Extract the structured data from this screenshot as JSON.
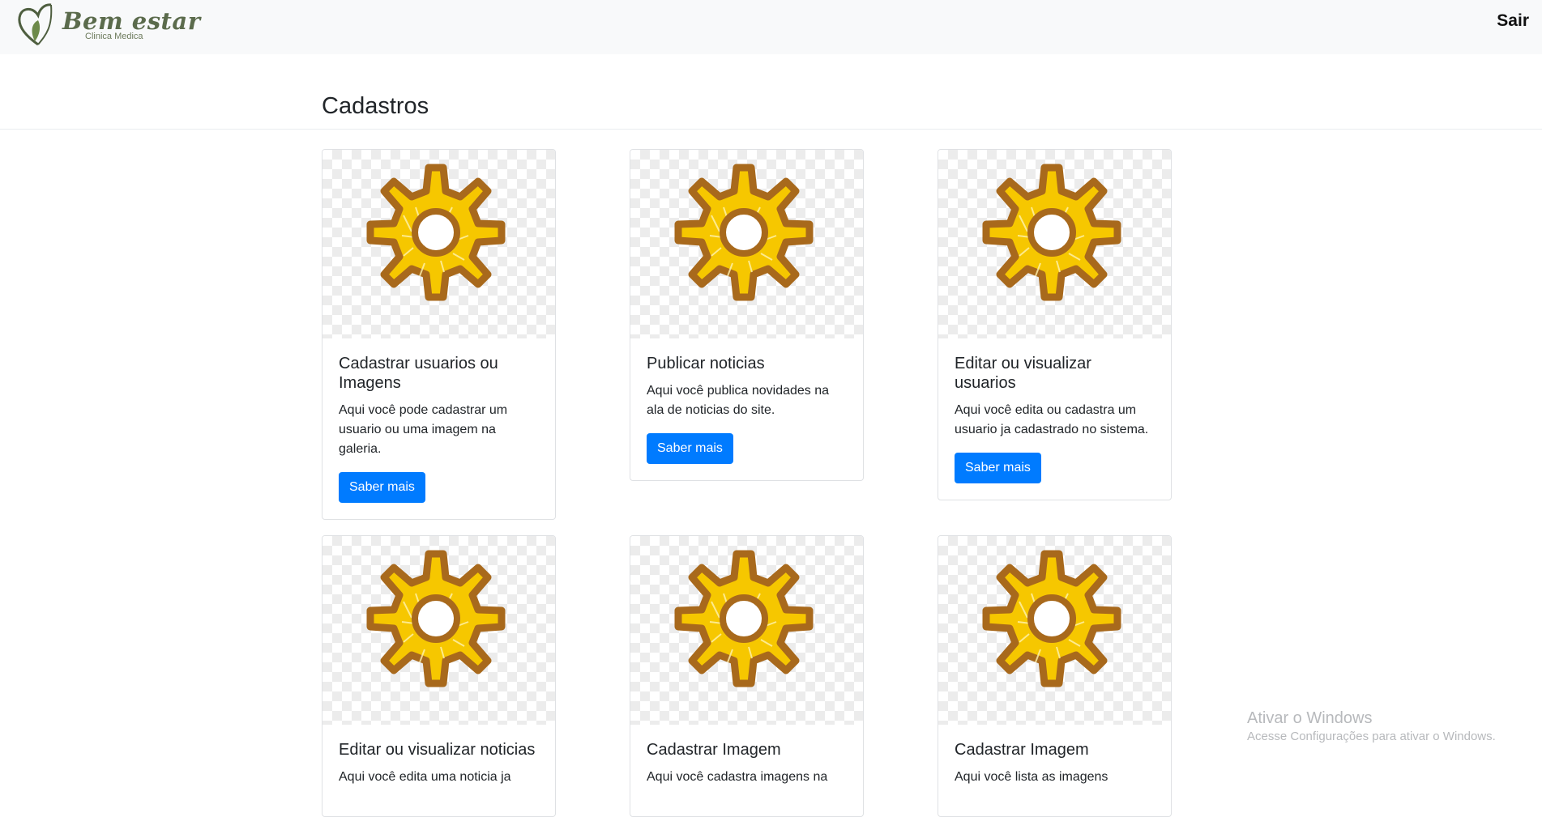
{
  "app": {
    "brand": "Bem estar",
    "subtitle": "Clinica Medica",
    "logout_label": "Sair"
  },
  "page": {
    "title": "Cadastros"
  },
  "cards": [
    {
      "title": "Cadastrar usuarios ou Imagens",
      "text": "Aqui você pode cadastrar um usuario ou uma imagem na galeria.",
      "button": "Saber mais",
      "icon": "gear-icon"
    },
    {
      "title": "Publicar noticias",
      "text": "Aqui você publica novidades na ala de noticias do site.",
      "button": "Saber mais",
      "icon": "gear-icon"
    },
    {
      "title": "Editar ou visualizar usuarios",
      "text": "Aqui você edita ou cadastra um usuario ja cadastrado no sistema.",
      "button": "Saber mais",
      "icon": "gear-icon"
    },
    {
      "title": "Editar ou visualizar noticias",
      "text": "Aqui você edita uma noticia ja",
      "icon": "gear-icon"
    },
    {
      "title": "Cadastrar Imagem",
      "text": "Aqui você cadastra imagens na",
      "icon": "gear-icon"
    },
    {
      "title": "Cadastrar Imagem",
      "text": "Aqui você lista as imagens",
      "icon": "gear-icon"
    }
  ],
  "watermark": {
    "title": "Ativar o Windows",
    "subtitle": "Acesse Configurações para ativar o Windows."
  },
  "colors": {
    "primary": "#007bff",
    "navbar_bg": "#f8f9fa",
    "gear_fill": "#f6c700",
    "gear_outline": "#a8691c",
    "brand_green": "#5b6b4c"
  }
}
